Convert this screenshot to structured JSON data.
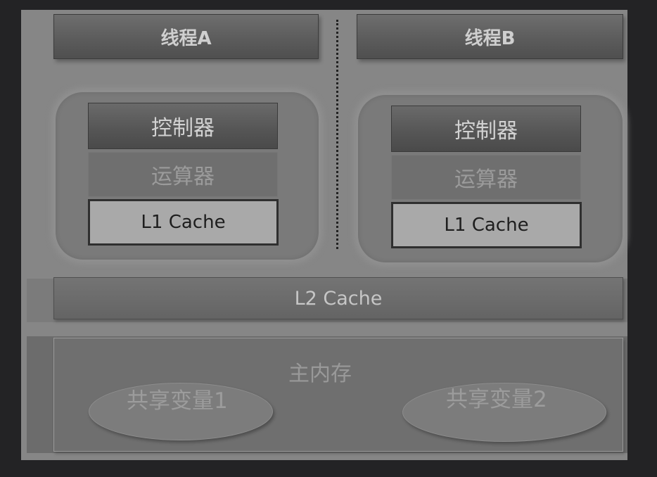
{
  "threads": [
    {
      "title": "线程A",
      "controller": "控制器",
      "alu": "运算器",
      "l1": "L1 Cache"
    },
    {
      "title": "线程B",
      "controller": "控制器",
      "alu": "运算器",
      "l1": "L1 Cache"
    }
  ],
  "l2": "L2 Cache",
  "memory": {
    "label": "主内存",
    "variables": [
      "共享变量1",
      "共享变量2"
    ]
  },
  "colors": {
    "background": "#232325",
    "canvas": "#868686",
    "header": "#5c5c5c",
    "l1_fill": "#a9a9a9",
    "memory": "#6f6f6f"
  }
}
